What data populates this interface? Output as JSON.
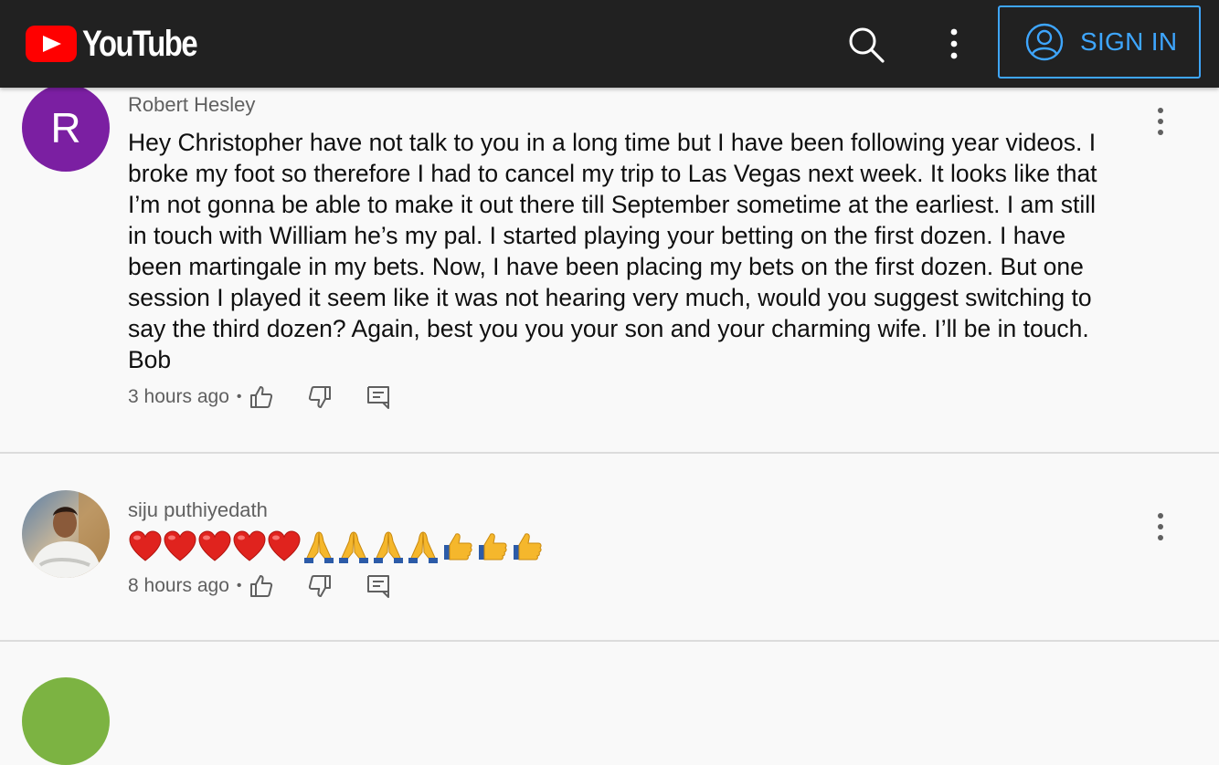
{
  "header": {
    "logo_text": "YouTube",
    "signin_label": "SIGN IN",
    "accent": "#3ea6ff",
    "brand_red": "#ff0000"
  },
  "comments": [
    {
      "avatar_letter": "R",
      "avatar_color": "#7b1fa2",
      "author": "Robert Hesley",
      "text": "Hey Christopher have not talk to you in a long time but I have been following year videos. I broke my foot so therefore I had to cancel my trip to Las Vegas next week. It looks like that I’m not gonna be able to make it out there till September sometime at the earliest. I am still in touch with William he’s my pal. I started playing your betting on the first dozen.   I have been martingale in my bets.  Now, I have been placing my bets on the first dozen. But one session I played it seem like it was not hearing very much, would you suggest switching to say the third dozen?    Again, best you you your son and your charming wife. I’ll be in touch.   Bob",
      "time": "3 hours ago",
      "dot": "•"
    },
    {
      "author": "siju puthiyedath",
      "emoji": [
        "heart",
        "heart",
        "heart",
        "heart",
        "heart",
        "pray",
        "pray",
        "pray",
        "pray",
        "thumbs-up",
        "thumbs-up",
        "thumbs-up"
      ],
      "time": "8 hours ago",
      "dot": "•"
    }
  ]
}
